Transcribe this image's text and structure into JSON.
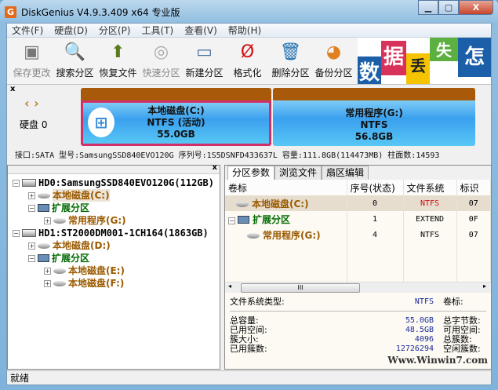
{
  "window": {
    "title": "DiskGenius V4.9.3.409 x64 专业版",
    "min": "▁",
    "max": "▢",
    "close": "X"
  },
  "menu": [
    "文件(F)",
    "硬盘(D)",
    "分区(P)",
    "工具(T)",
    "查看(V)",
    "帮助(H)"
  ],
  "toolbar": [
    {
      "label": "保存更改",
      "icon": "save-icon",
      "glyph": "▣",
      "enabled": false
    },
    {
      "label": "搜索分区",
      "icon": "search-icon",
      "glyph": "🔍",
      "enabled": true
    },
    {
      "label": "恢复文件",
      "icon": "recover-icon",
      "glyph": "⬆",
      "enabled": true
    },
    {
      "label": "快速分区",
      "icon": "quick-partition-icon",
      "glyph": "◎",
      "enabled": false
    },
    {
      "label": "新建分区",
      "icon": "new-partition-icon",
      "glyph": "▭",
      "enabled": true
    },
    {
      "label": "格式化",
      "icon": "format-icon",
      "glyph": "Ø",
      "enabled": true
    },
    {
      "label": "删除分区",
      "icon": "delete-icon",
      "glyph": "🗑",
      "enabled": true
    },
    {
      "label": "备份分区",
      "icon": "backup-icon",
      "glyph": "◕",
      "enabled": true
    }
  ],
  "banner": [
    "数",
    "据",
    "丢",
    "失",
    "怎"
  ],
  "diskmap": {
    "close": "x",
    "nav": "‹ ›",
    "disk_label": "硬盘 0",
    "partitions": [
      {
        "name": "本地磁盘(C:)",
        "fs": "NTFS (活动)",
        "size": "55.0GB"
      },
      {
        "name": "常用程序(G:)",
        "fs": "NTFS",
        "size": "56.8GB"
      }
    ],
    "info": "接口:SATA  型号:SamsungSSD840EVO120G  序列号:1S5DSNFD433637L  容量:111.8GB(114473MB)  柱面数:14593"
  },
  "tree": {
    "close": "x",
    "items": [
      {
        "text": "HD0:SamsungSSD840EVO120G(112GB)",
        "type": "disk",
        "level": 0,
        "pm": "−"
      },
      {
        "text": "本地磁盘(C:)",
        "type": "vol",
        "level": 1,
        "pm": "+"
      },
      {
        "text": "扩展分区",
        "type": "ext",
        "level": 1,
        "pm": "−"
      },
      {
        "text": "常用程序(G:)",
        "type": "vol",
        "level": 2,
        "pm": "+"
      },
      {
        "text": "HD1:ST2000DM001-1CH164(1863GB)",
        "type": "disk",
        "level": 0,
        "pm": "−"
      },
      {
        "text": "本地磁盘(D:)",
        "type": "vol",
        "level": 1,
        "pm": "+"
      },
      {
        "text": "扩展分区",
        "type": "ext",
        "level": 1,
        "pm": "−"
      },
      {
        "text": "本地磁盘(E:)",
        "type": "vol",
        "level": 2,
        "pm": "+"
      },
      {
        "text": "本地磁盘(F:)",
        "type": "vol",
        "level": 2,
        "pm": "+"
      }
    ]
  },
  "tabs": [
    "分区参数",
    "浏览文件",
    "扇区编辑"
  ],
  "table": {
    "headers": [
      "卷标",
      "序号(状态)",
      "文件系统",
      "标识"
    ],
    "rows": [
      {
        "name": "本地磁盘(C:)",
        "idx": "0",
        "fs": "NTFS",
        "id": "07",
        "type": "vol"
      },
      {
        "name": "扩展分区",
        "idx": "1",
        "fs": "EXTEND",
        "id": "0F",
        "type": "ext"
      },
      {
        "name": "常用程序(G:)",
        "idx": "4",
        "fs": "NTFS",
        "id": "07",
        "type": "vol"
      }
    ]
  },
  "details": {
    "fs_label": "文件系统类型:",
    "fs_value": "NTFS",
    "vol_label": "卷标:",
    "rows": [
      {
        "l": "总容量:",
        "v": "55.0GB",
        "r": "总字节数:"
      },
      {
        "l": "已用空间:",
        "v": "48.5GB",
        "r": "可用空间:"
      },
      {
        "l": "簇大小:",
        "v": "4096",
        "r": "总簇数:"
      },
      {
        "l": "已用簇数:",
        "v": "12726294",
        "r": "空闲簇数:"
      }
    ]
  },
  "status": "就绪",
  "watermark": "Www.Winwin7.com",
  "colors": {
    "accent_border": "#d0306a",
    "brown": "#a85a0a"
  }
}
